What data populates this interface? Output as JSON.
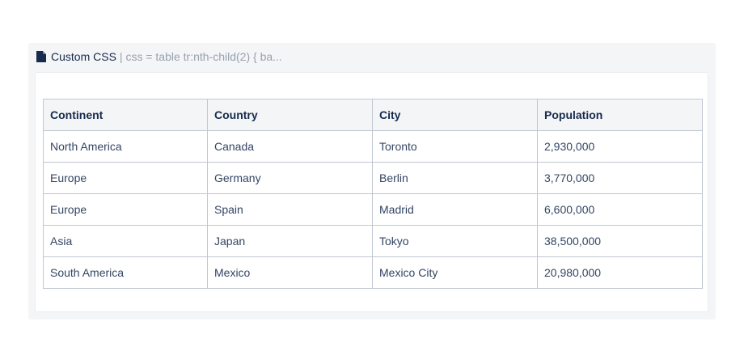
{
  "macro": {
    "title": "Custom CSS",
    "params": "| css = table tr:nth-child(2) { ba...",
    "icon": "document-icon"
  },
  "table": {
    "headers": [
      "Continent",
      "Country",
      "City",
      "Population"
    ],
    "rows": [
      [
        "North America",
        "Canada",
        "Toronto",
        "2,930,000"
      ],
      [
        "Europe",
        "Germany",
        "Berlin",
        "3,770,000"
      ],
      [
        "Europe",
        "Spain",
        "Madrid",
        "6,600,000"
      ],
      [
        "Asia",
        "Japan",
        "Tokyo",
        "38,500,000"
      ],
      [
        "South America",
        "Mexico",
        "Mexico City",
        "20,980,000"
      ]
    ]
  },
  "colors": {
    "panel_bg": "#f4f5f7",
    "header_bg": "#f4f5f7",
    "border": "#c1c7d0",
    "text": "#172b4d",
    "muted": "#97a0af"
  }
}
